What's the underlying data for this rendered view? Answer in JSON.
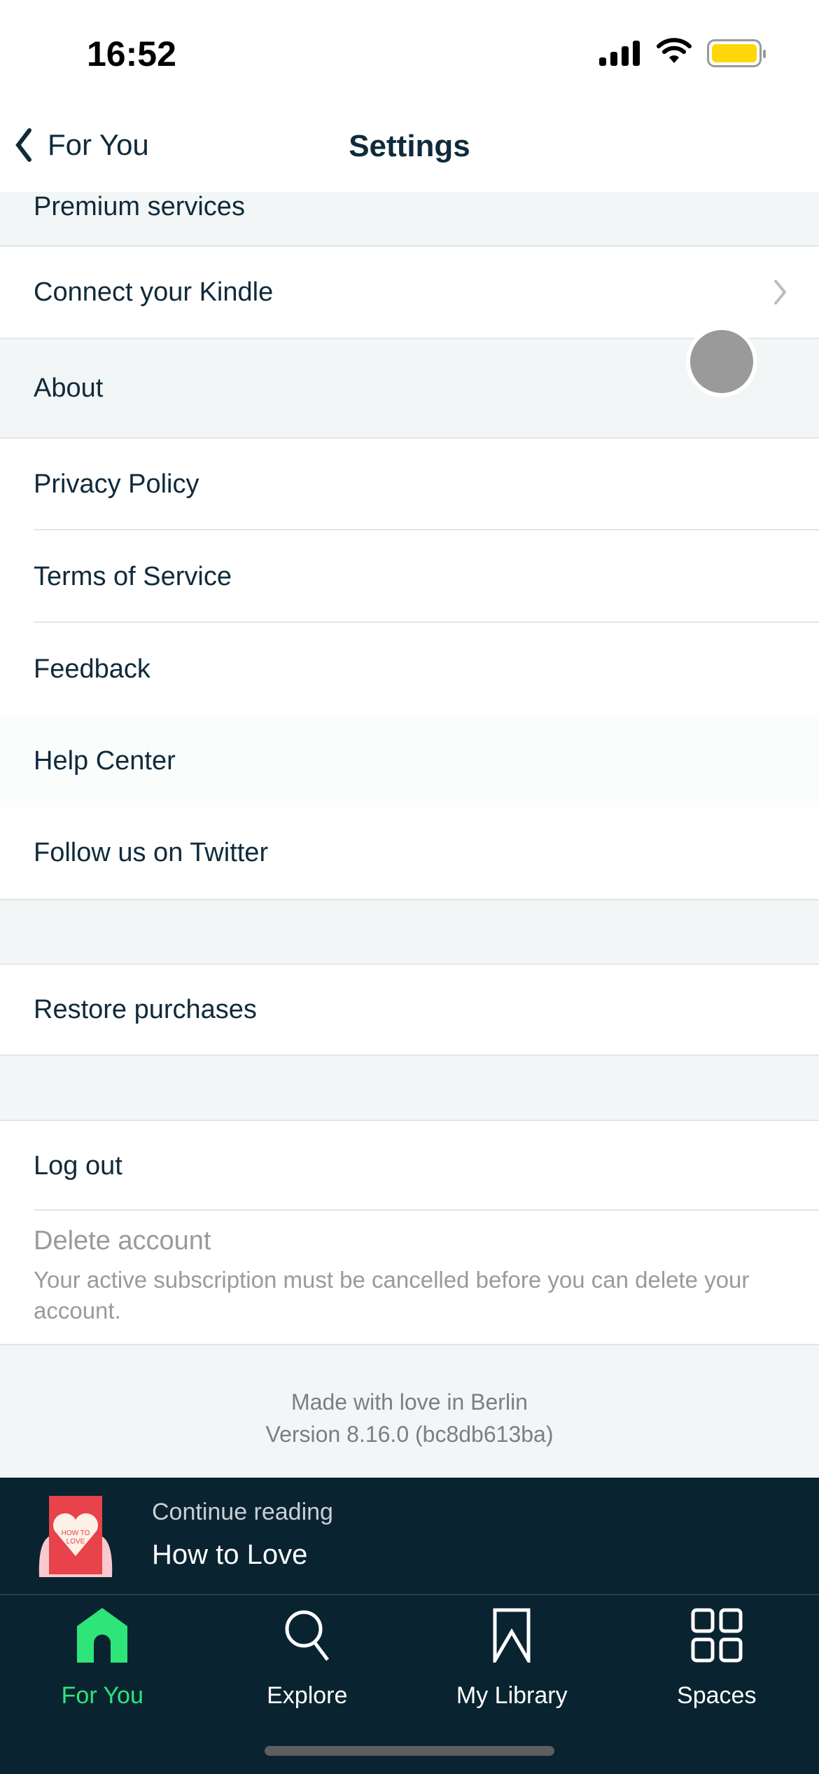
{
  "status_bar": {
    "time": "16:52"
  },
  "nav": {
    "back_label": "For You",
    "title": "Settings"
  },
  "sections": {
    "premium": "Premium services",
    "kindle": "Connect your Kindle",
    "about": "About",
    "about_items": [
      "Privacy Policy",
      "Terms of Service",
      "Feedback",
      "Help Center",
      "Follow us on Twitter"
    ],
    "restore": "Restore purchases",
    "logout": "Log out",
    "delete_title": "Delete account",
    "delete_desc": "Your active subscription must be cancelled before you can delete your account."
  },
  "footer": {
    "line1": "Made with love in Berlin",
    "line2": "Version 8.16.0 (bc8db613ba)"
  },
  "mini_player": {
    "label": "Continue reading",
    "book": "How to Love",
    "cover_text": "HOW TO LOVE"
  },
  "tabs": [
    {
      "label": "For You",
      "icon": "home-icon",
      "active": true
    },
    {
      "label": "Explore",
      "icon": "search-icon"
    },
    {
      "label": "My Library",
      "icon": "bookmark-icon"
    },
    {
      "label": "Spaces",
      "icon": "grid-icon"
    }
  ],
  "colors": {
    "accent": "#2ee57a",
    "text": "#0f2a3b",
    "bar": "#0a2330",
    "battery": "#ffd60a"
  }
}
